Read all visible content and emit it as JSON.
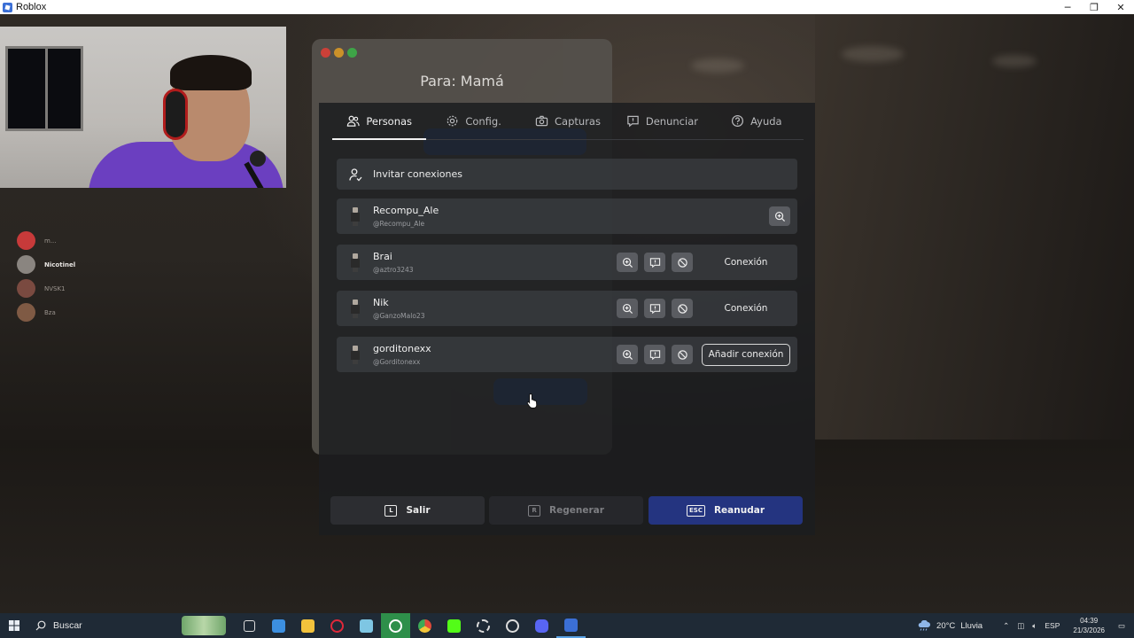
{
  "window": {
    "title": "Roblox",
    "controls": [
      "─",
      "❐",
      "✕"
    ]
  },
  "discord": {
    "users": [
      {
        "name": "m...",
        "avatar_color": "#c73a3a"
      },
      {
        "name": "Nicotinel",
        "avatar_color": "#8a8580"
      },
      {
        "name": "NVSK1",
        "avatar_color": "#7a4a40"
      },
      {
        "name": "Bza",
        "avatar_color": "#7f5a44"
      }
    ]
  },
  "chat": {
    "title": "Para: Mamá"
  },
  "tabs": [
    {
      "label": "Personas",
      "icon": "people-icon",
      "active": true
    },
    {
      "label": "Config.",
      "icon": "gear-icon",
      "active": false
    },
    {
      "label": "Capturas",
      "icon": "camera-icon",
      "active": false
    },
    {
      "label": "Denunciar",
      "icon": "report-icon",
      "active": false
    },
    {
      "label": "Ayuda",
      "icon": "help-icon",
      "active": false
    }
  ],
  "invite": {
    "label": "Invitar conexiones"
  },
  "people": [
    {
      "name": "Recompu_Ale",
      "handle": "@Recompu_Ale",
      "action": ""
    },
    {
      "name": "Brai",
      "handle": "@aztro3243",
      "action": "Conexión"
    },
    {
      "name": "Nik",
      "handle": "@GanzoMalo23",
      "action": "Conexión"
    },
    {
      "name": "gorditonexx",
      "handle": "@Gorditonexx",
      "action": "Añadir conexión"
    }
  ],
  "bottom_buttons": {
    "salir": {
      "key": "L",
      "label": "Salir"
    },
    "regenerar": {
      "key": "R",
      "label": "Regenerar"
    },
    "reanudar": {
      "key": "ESC",
      "label": "Reanudar"
    }
  },
  "taskbar": {
    "search_placeholder": "Buscar",
    "weather_temp": "20°C",
    "weather_desc": "Lluvia",
    "language": "ESP",
    "time": "04:39",
    "date": "21/3/2026"
  },
  "colors": {
    "accent_blue": "#243480",
    "taskbar": "#1f2a36"
  }
}
